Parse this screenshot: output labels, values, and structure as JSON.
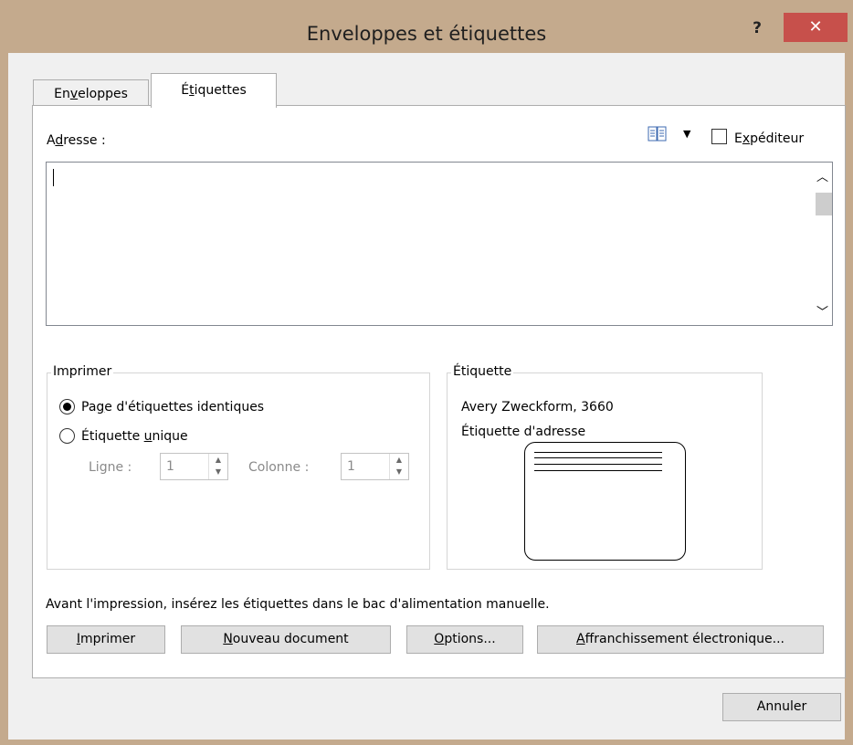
{
  "window": {
    "title": "Enveloppes et étiquettes",
    "help_label": "?",
    "close_label": "✕"
  },
  "tabs": [
    {
      "pre": "En",
      "ul": "v",
      "post": "eloppes",
      "active": false
    },
    {
      "pre": "É",
      "ul": "t",
      "post": "iquettes",
      "active": true
    }
  ],
  "address": {
    "label_pre": "A",
    "label_ul": "d",
    "label_post": "resse :",
    "value": "",
    "addressbook_icon": "address-book-icon",
    "sender_pre": "E",
    "sender_ul": "x",
    "sender_post": "péditeur",
    "sender_checked": false
  },
  "print_group": {
    "title": "Imprimer",
    "option_full_pre": "Pa",
    "option_full_ul": "g",
    "option_full_post": "e d'étiquettes identiques",
    "option_single_pre": "Étiquette ",
    "option_single_ul": "u",
    "option_single_post": "nique",
    "selected": "full",
    "ligne_label": "Ligne :",
    "ligne_value": "1",
    "colonne_label": "Colonne :",
    "colonne_value": "1"
  },
  "label_group": {
    "title": "Étiquette",
    "line1": "Avery Zweckform, 3660",
    "line2": "Étiquette d'adresse"
  },
  "note": "Avant l'impression, insérez les étiquettes dans le bac d'alimentation manuelle.",
  "buttons": {
    "print_ul": "I",
    "print_post": "mprimer",
    "newdoc_ul": "N",
    "newdoc_post": "ouveau document",
    "options_ul": "O",
    "options_post": "ptions...",
    "postage_ul": "A",
    "postage_post": "ffranchissement électronique...",
    "cancel": "Annuler"
  }
}
